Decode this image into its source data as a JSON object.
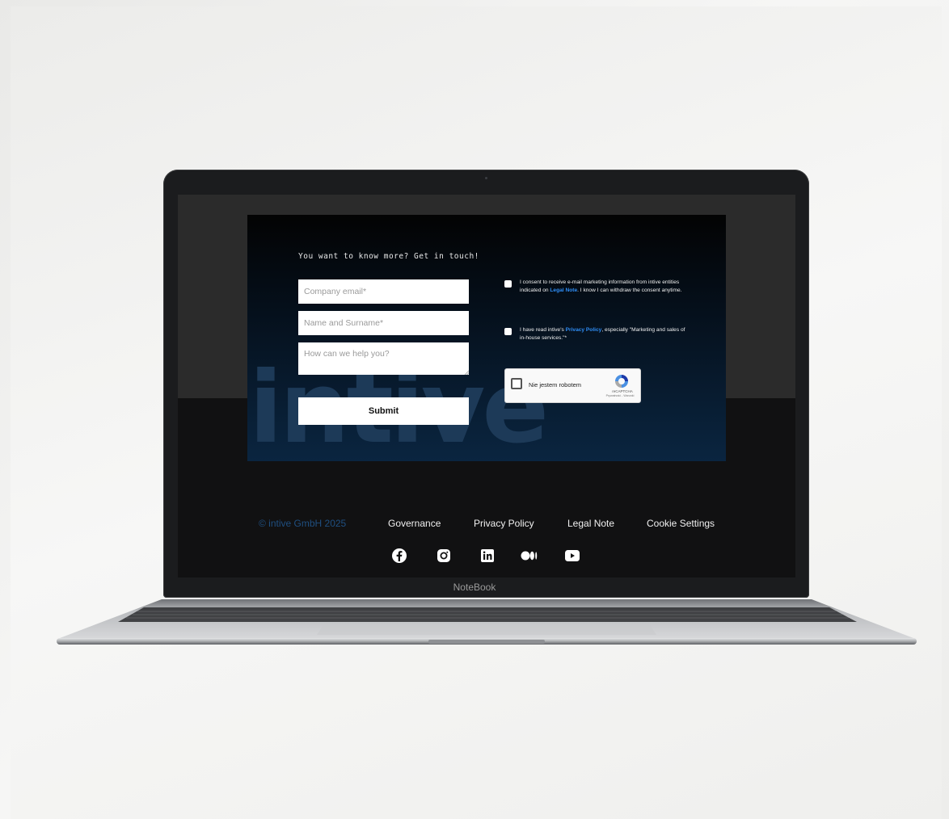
{
  "form": {
    "heading": "You want to know more? Get in touch!",
    "email_placeholder": "Company email*",
    "name_placeholder": "Name and Surname*",
    "help_placeholder": "How can we help you?",
    "submit_label": "Submit",
    "consent_marketing": {
      "before": "I consent to receive e-mail marketing information from intive entities indicated on ",
      "link": "Legal Note",
      "after": ". I know I can withdraw the consent anytime."
    },
    "consent_privacy": {
      "before": "I have read intive's ",
      "link": "Privacy Policy",
      "after": ", especially \"Marketing and sales of in-house services.\"*"
    },
    "captcha": {
      "label": "Nie jestem robotem",
      "brand": "reCAPTCHA",
      "terms": "Prywatność - Warunki"
    },
    "watermark": "intive"
  },
  "footer": {
    "copyright": "© intive GmbH 2025",
    "links": [
      "Governance",
      "Privacy Policy",
      "Legal Note",
      "Cookie Settings"
    ],
    "socials": [
      "facebook-icon",
      "instagram-icon",
      "linkedin-icon",
      "medium-icon",
      "youtube-icon"
    ]
  },
  "device": {
    "label": "NoteBook"
  },
  "colors": {
    "accent_link": "#2f8ef6",
    "copyright": "#1f4f80",
    "panel_gradient_end": "#0a2540"
  }
}
